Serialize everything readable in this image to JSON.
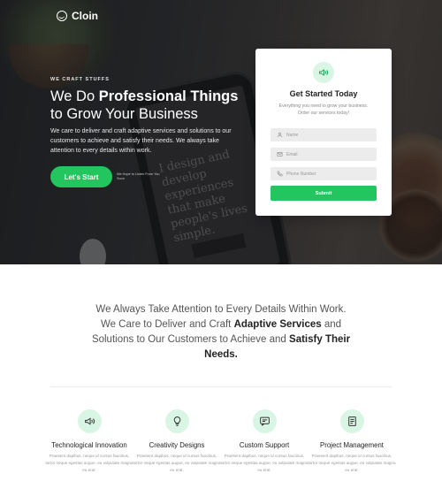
{
  "brand": {
    "name": "Cloin",
    "logo_icon": "layers-circle-icon"
  },
  "hero": {
    "eyebrow": "WE CRAFT STUFFS",
    "headline_regular_1": "We Do ",
    "headline_bold": "Professional Things",
    "headline_regular_2": "to Grow Your Business",
    "lead": "We care to deliver and craft adaptive services and solutions to our customers to achieve and satisfy their needs. We always take attention to every details within work.",
    "cta_label": "Let's Start",
    "cta_note": "We Hope to Listen From You Soon",
    "phone_text": "I design and develop experiences that make people's lives simple."
  },
  "form": {
    "icon": "megaphone-icon",
    "title": "Get Started Today",
    "subtitle": "Everything you need to grow your business. Order our services today!",
    "name_placeholder": "Name",
    "email_placeholder": "Email",
    "phone_placeholder": "Phone Number",
    "submit_label": "Submit"
  },
  "statement": {
    "part1": "We Always Take Attention to Every Details Within Work. We Care to Deliver and Craft ",
    "bold1": "Adaptive Services",
    "part2": " and Solutions to Our Customers to Achieve and ",
    "bold2": "Satisfy Their Needs."
  },
  "features": [
    {
      "icon": "megaphone-icon",
      "title": "Technological Innovation",
      "text": "Praesent dapibus, neque id cursus faucibus, tortor neque egestas augue, eu vulputate magna eu erat."
    },
    {
      "icon": "lightbulb-icon",
      "title": "Creativity Designs",
      "text": "Praesent dapibus, neque id cursus faucibus, tortor neque egestas augue, eu vulputate magna eu erat."
    },
    {
      "icon": "chat-icon",
      "title": "Custom Support",
      "text": "Praesent dapibus, neque id cursus faucibus, tortor neque egestas augue, eu vulputate magna eu erat."
    },
    {
      "icon": "document-icon",
      "title": "Project Management",
      "text": "Praesent dapibus, neque id cursus faucibus, tortor neque egestas augue, eu vulputate magna eu erat."
    }
  ],
  "colors": {
    "accent": "#22c55e",
    "accent_light": "#d9f5e4",
    "hero_dark": "#2a2c2e"
  }
}
